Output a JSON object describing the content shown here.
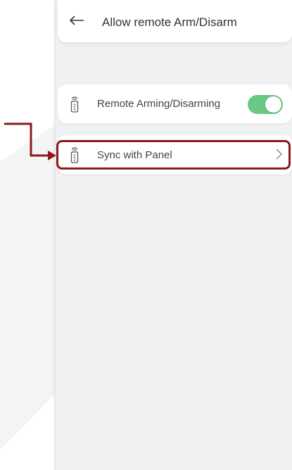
{
  "header": {
    "back_icon": "left-arrow-icon",
    "title": "Allow remote Arm/Disarm"
  },
  "settings": [
    {
      "icon": "remote-control-icon",
      "label": "Remote Arming/Disarming",
      "control": "toggle",
      "enabled": true
    },
    {
      "icon": "remote-control-icon",
      "label": "Sync with Panel",
      "control": "chevron-right-icon"
    }
  ],
  "colors": {
    "toggle_on": "#69c884",
    "highlight": "#8b1a1a",
    "screen_bg": "#f1f1f3"
  }
}
